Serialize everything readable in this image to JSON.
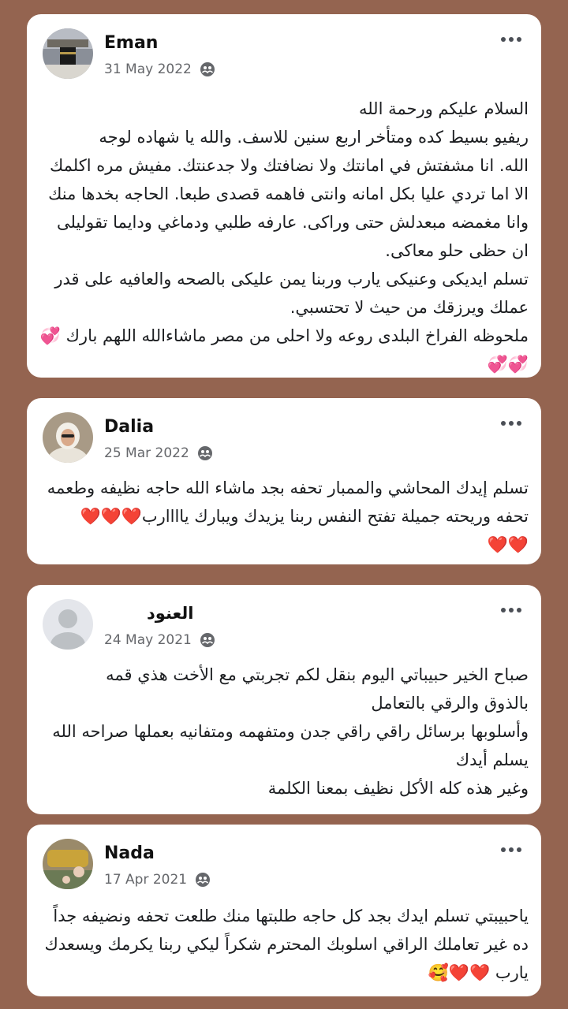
{
  "posts": [
    {
      "name": "Eman",
      "date": "31 May 2022",
      "lines": [
        "السلام عليكم ورحمة الله",
        "ريفيو بسيط كده ومتأخر اربع سنين للاسف. والله يا         شهاده لوجه",
        "الله. انا مشفتش في امانتك ولا نضافتك ولا جدعنتك. مفيش مره اكلمك",
        "الا اما تردي عليا بكل امانه وانتى فاهمه قصدى طبعا. الحاجه بخدها منك",
        "وانا مغمضه مبعدلش حتى وراكى. عارفه طلبي ودماغي ودايما تقوليلى",
        "ان حظى حلو معاكى.",
        "تسلم ايديكى وعنيكى يارب وربنا يمن عليكى بالصحه والعافيه على قدر",
        "عملك ويرزقك من حيث لا تحتسبي.",
        "ملحوظه الفراخ البلدى روعه ولا احلى من مصر ماشاءالله اللهم بارك 💞",
        "💞💞"
      ]
    },
    {
      "name": "Dalia",
      "date": "25 Mar 2022",
      "lines": [
        "تسلم إيدك المحاشي والممبار تحفه بجد ماشاء الله حاجه نظيفه وطعمه",
        "تحفه وريحته جميلة تفتح النفس  ربنا يزيدك ويبارك ياااارب❤️❤️❤️",
        "❤️❤️"
      ]
    },
    {
      "name": "العنود",
      "date": "24 May 2021",
      "lines": [
        "صباح الخير حبيباتي اليوم بنقل لكم تجربتي مع          الأخت هذي قمه",
        "بالذوق والرقي بالتعامل",
        "وأسلوبها برسائل راقي راقي جدن ومتفهمه ومتفانيه بعملها صراحه الله",
        "يسلم أيدك",
        "وغير هذه كله الأكل نظيف بمعنا الكلمة"
      ]
    },
    {
      "name": "Nada",
      "date": "17 Apr 2021",
      "lines": [
        "ياحبيبتي تسلم ايدك بجد كل حاجه طلبتها منك طلعت تحفه ونضيفه جداً",
        "ده غير تعاملك الراقي اسلوبك المحترم شكراً ليكي ربنا يكرمك ويسعدك",
        "يارب ❤️❤️🥰"
      ]
    }
  ]
}
